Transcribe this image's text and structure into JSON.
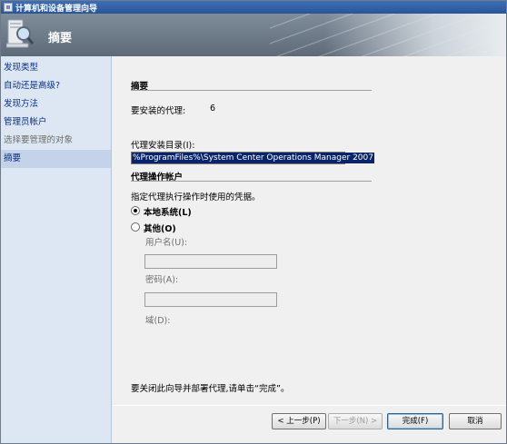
{
  "window": {
    "title": "计算机和设备管理向导"
  },
  "header": {
    "title": "摘要",
    "icon": "magnifier-computer-icon"
  },
  "nav": {
    "items": [
      {
        "label": "发现类型",
        "state": "normal"
      },
      {
        "label": "自动还是高级?",
        "state": "normal"
      },
      {
        "label": "发现方法",
        "state": "normal"
      },
      {
        "label": "管理员帐户",
        "state": "normal"
      },
      {
        "label": "选择要管理的对象",
        "state": "disabled"
      },
      {
        "label": "摘要",
        "state": "selected"
      }
    ]
  },
  "summary": {
    "section_title": "摘要",
    "agents_label": "要安装的代理:",
    "agents_count": "6",
    "install_dir_label": "代理安装目录(I):",
    "install_dir_value": "%ProgramFiles%\\System Center Operations Manager 2007"
  },
  "agent_account": {
    "section_title": "代理操作帐户",
    "description": "指定代理执行操作时使用的凭据。",
    "option_local": "本地系统(L)",
    "option_other": "其他(O)",
    "selected": "local",
    "username_label": "用户名(U):",
    "password_label": "密码(A):",
    "domain_label": "域(D):"
  },
  "footer_note": "要关闭此向导并部署代理,请单击“完成”。",
  "buttons": {
    "back": "< 上一步(P)",
    "next": "下一步(N) >",
    "finish": "完成(F)",
    "cancel": "取消"
  },
  "colors": {
    "nav_bg": "#dde7f3",
    "nav_text": "#0a2f86",
    "selection": "#0a246a"
  }
}
